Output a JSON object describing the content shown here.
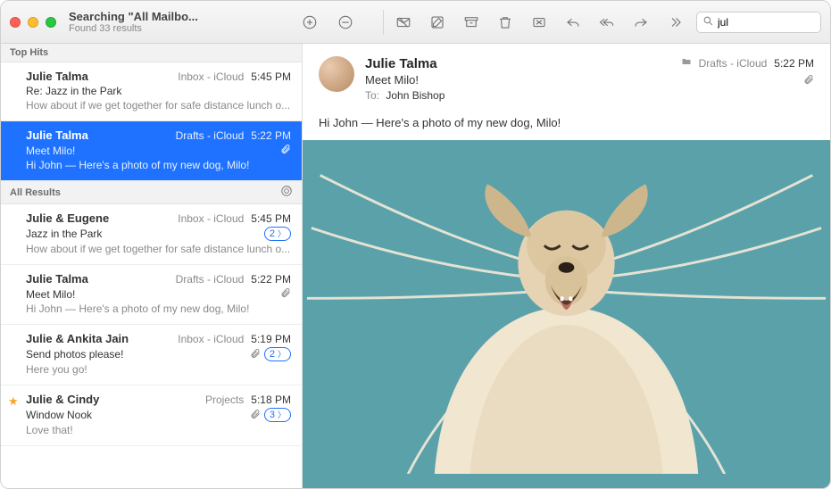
{
  "window": {
    "title": "Searching \"All Mailbo...",
    "subtitle": "Found 33 results"
  },
  "search": {
    "value": "jul"
  },
  "sections": {
    "top_hits_label": "Top Hits",
    "all_results_label": "All Results"
  },
  "top_hits": [
    {
      "sender": "Julie Talma",
      "location": "Inbox - iCloud",
      "time": "5:45 PM",
      "subject": "Re: Jazz in the Park",
      "preview": "How about if we get together for safe distance lunch o..."
    },
    {
      "sender": "Julie Talma",
      "location": "Drafts - iCloud",
      "time": "5:22 PM",
      "subject": "Meet Milo!",
      "preview": "Hi John — Here's a photo of my new dog, Milo!",
      "has_attachment": true,
      "selected": true
    }
  ],
  "all_results": [
    {
      "sender": "Julie & Eugene",
      "location": "Inbox - iCloud",
      "time": "5:45 PM",
      "subject": "Jazz in the Park",
      "preview": "How about if we get together for safe distance lunch o...",
      "thread_count": "2"
    },
    {
      "sender": "Julie Talma",
      "location": "Drafts - iCloud",
      "time": "5:22 PM",
      "subject": "Meet Milo!",
      "preview": "Hi John — Here's a photo of my new dog, Milo!",
      "has_attachment": true
    },
    {
      "sender": "Julie & Ankita Jain",
      "location": "Inbox - iCloud",
      "time": "5:19 PM",
      "subject": "Send photos please!",
      "preview": "Here you go!",
      "has_attachment": true,
      "thread_count": "2"
    },
    {
      "sender": "Julie & Cindy",
      "location": "Projects",
      "time": "5:18 PM",
      "subject": "Window Nook",
      "preview": "Love that!",
      "has_attachment": true,
      "thread_count": "3",
      "starred": true
    }
  ],
  "message": {
    "sender": "Julie Talma",
    "subject": "Meet Milo!",
    "to_label": "To:",
    "recipient": "John Bishop",
    "folder": "Drafts - iCloud",
    "time": "5:22 PM",
    "body": "Hi John — Here's a photo of my new dog, Milo!"
  }
}
